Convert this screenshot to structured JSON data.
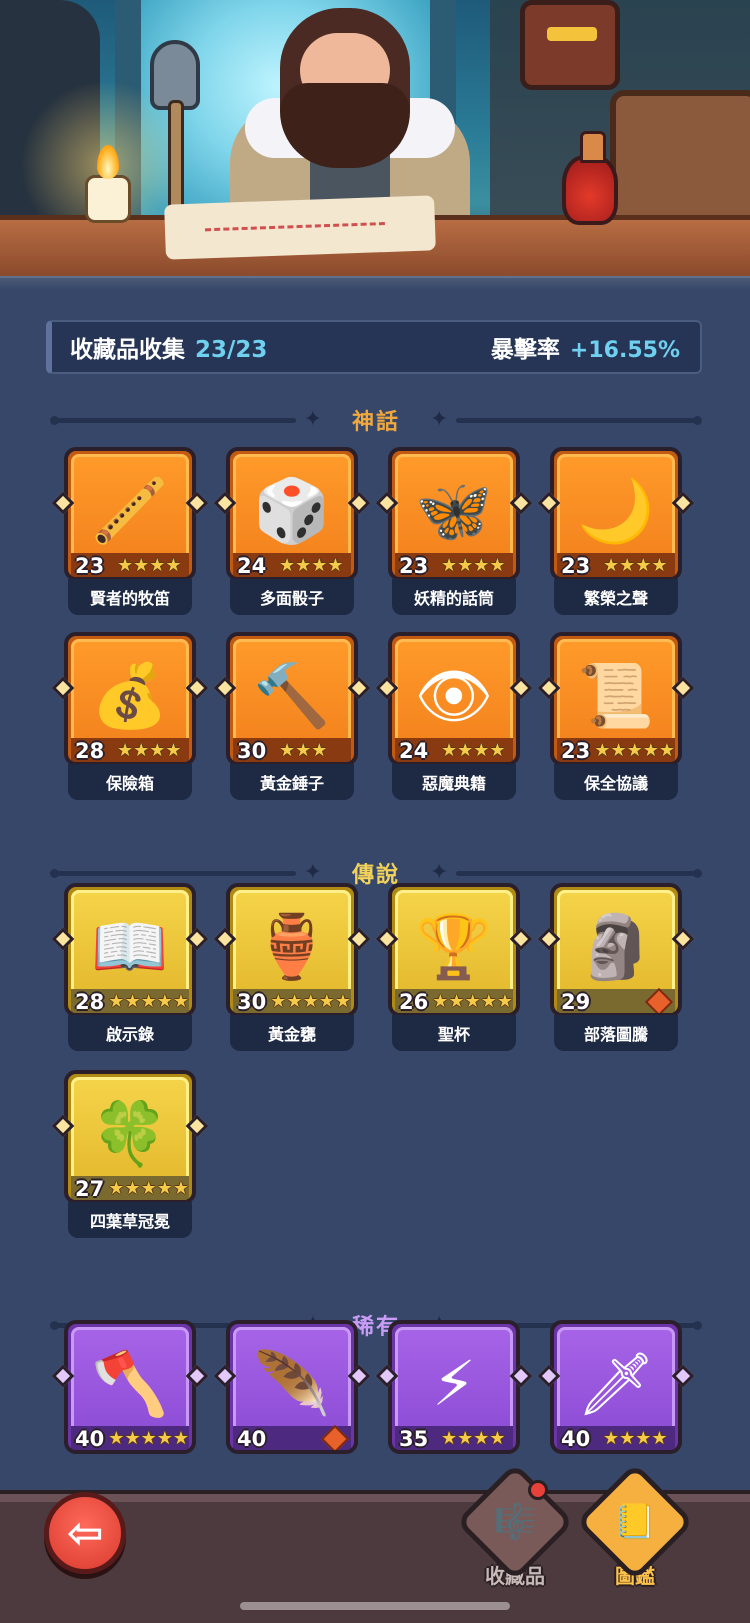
{
  "collection": {
    "label": "收藏品收集",
    "count": "23/23",
    "bonus_label": "暴擊率",
    "bonus_value": "+16.55%"
  },
  "sections": {
    "myth": "神話",
    "legend": "傳說",
    "rare": "稀有"
  },
  "myth_items": [
    {
      "name": "賢者的牧笛",
      "level": "23",
      "stars": 4,
      "stars_max": 4,
      "icon": "flute-icon",
      "glyph": "🪈"
    },
    {
      "name": "多面骰子",
      "level": "24",
      "stars": 4,
      "stars_max": 4,
      "icon": "dice-icon",
      "glyph": "🎲"
    },
    {
      "name": "妖精的話筒",
      "level": "23",
      "stars": 4,
      "stars_max": 4,
      "icon": "fairy-microphone-icon",
      "glyph": "🦋"
    },
    {
      "name": "繁榮之聲",
      "level": "23",
      "stars": 4,
      "stars_max": 4,
      "icon": "moon-orb-icon",
      "glyph": "🌙"
    },
    {
      "name": "保險箱",
      "level": "28",
      "stars": 4,
      "stars_max": 4,
      "icon": "treasure-chest-icon",
      "glyph": "💰"
    },
    {
      "name": "黃金錘子",
      "level": "30",
      "stars": 3,
      "stars_max": 3,
      "icon": "hammer-icon",
      "glyph": "🔨"
    },
    {
      "name": "惡魔典籍",
      "level": "24",
      "stars": 4,
      "stars_max": 4,
      "icon": "demon-book-icon",
      "glyph": "👁"
    },
    {
      "name": "保全協議",
      "level": "23",
      "stars": 5,
      "stars_max": 5,
      "icon": "contract-scroll-icon",
      "glyph": "📜"
    }
  ],
  "legend_items": [
    {
      "name": "啟示錄",
      "level": "28",
      "stars": 5,
      "stars_max": 5,
      "icon": "open-book-icon",
      "glyph": "📖"
    },
    {
      "name": "黃金甕",
      "level": "30",
      "stars": 5,
      "stars_max": 5,
      "icon": "golden-urn-icon",
      "glyph": "🏺"
    },
    {
      "name": "聖杯",
      "level": "26",
      "stars": 5,
      "stars_max": 5,
      "icon": "holy-grail-icon",
      "glyph": "🏆"
    },
    {
      "name": "部落圖騰",
      "level": "29",
      "stars": 0,
      "stars_max": 0,
      "icon": "tribal-totem-icon",
      "glyph": "🗿",
      "badge": true
    },
    {
      "name": "四葉草冠冕",
      "level": "27",
      "stars": 5,
      "stars_max": 5,
      "icon": "clover-tiara-icon",
      "glyph": "🍀"
    }
  ],
  "rare_items": [
    {
      "name": "",
      "level": "40",
      "stars": 5,
      "stars_max": 5,
      "icon": "axe-icon",
      "glyph": "🪓"
    },
    {
      "name": "",
      "level": "40",
      "stars": 0,
      "stars_max": 0,
      "icon": "fire-feather-icon",
      "glyph": "🪶",
      "badge": true
    },
    {
      "name": "",
      "level": "35",
      "stars": 4,
      "stars_max": 4,
      "icon": "lightning-card-icon",
      "glyph": "⚡"
    },
    {
      "name": "",
      "level": "40",
      "stars": 4,
      "stars_max": 4,
      "icon": "ice-sword-icon",
      "glyph": "🗡"
    }
  ],
  "nav": {
    "back_icon": "back-arrow-icon",
    "collect_label": "收藏品",
    "book_label": "圖鑑"
  },
  "colors": {
    "myth": "#f2801c",
    "legend": "#e2b62a",
    "rare": "#8a4ad3",
    "accent_blue": "#6fd0ef"
  }
}
